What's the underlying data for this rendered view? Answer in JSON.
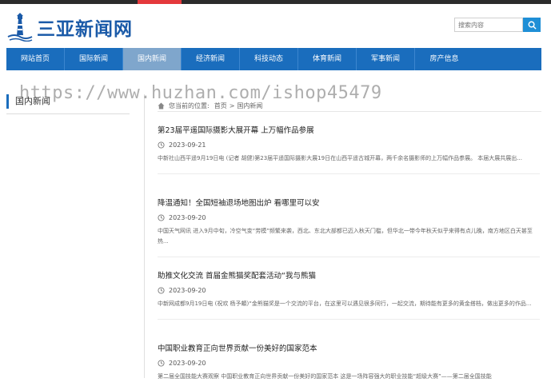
{
  "site": {
    "name": "三亚新闻网"
  },
  "search": {
    "placeholder": "搜索内容"
  },
  "nav": {
    "items": [
      {
        "label": "网站首页"
      },
      {
        "label": "国际新闻"
      },
      {
        "label": "国内新闻"
      },
      {
        "label": "经济新闻"
      },
      {
        "label": "科技动态"
      },
      {
        "label": "体育新闻"
      },
      {
        "label": "军事新闻"
      },
      {
        "label": "房产信息"
      }
    ],
    "active_index": 2
  },
  "watermark": "https://www.huzhan.com/ishop45479",
  "sidebar": {
    "title": "国内新闻"
  },
  "breadcrumb": {
    "prefix": "您当前的位置:",
    "home": "首页",
    "sep": ">",
    "current": "国内新闻"
  },
  "articles": [
    {
      "title": "第23届平遥国际摄影大展开幕 上万幅作品参展",
      "date": "2023-09-21",
      "summary": "中新社山西平遥9月19日电 (记者 胡健)第23届平遥国际摄影大展19日在山西平遥古城开幕，两千余名摄影师的上万幅作品参展。 本届大展共展出..."
    },
    {
      "title": "降温通知！全国短袖退场地图出炉 看哪里可以安",
      "date": "2023-09-20",
      "summary": "中国天气网讯 进入9月中旬，冷空气变“劳模”频繁来袭，西北、东北大部都已迈入秋天门槛，但华北一带今年秋天似乎来得有点儿晚，南方地区白天甚至热..."
    },
    {
      "title": "助推文化交流 首届金熊猫奖配套活动“我与熊猫",
      "date": "2023-09-20",
      "summary": "中新网成都9月19日电 (祝欢 杨予頔)“金熊猫奖是一个交流的平台，在这里可以遇见很多同行，一起交流，期待能有更多的黄金搭档，做出更多的作品..."
    },
    {
      "title": "中国职业教育正向世界贡献一份美好的国家范本",
      "date": "2023-09-20",
      "summary": "第二届全国技能大赛观察 中国职业教育正向世界贡献一份美好的国家范本 这是一场阵容强大的职业技能“超级大赛”——第二届全国技能"
    }
  ],
  "colors": {
    "nav_bg": "#1a6dbd",
    "nav_active": "#7fa6cc",
    "accent": "#e4393c",
    "search_btn": "#1f8fd6"
  }
}
